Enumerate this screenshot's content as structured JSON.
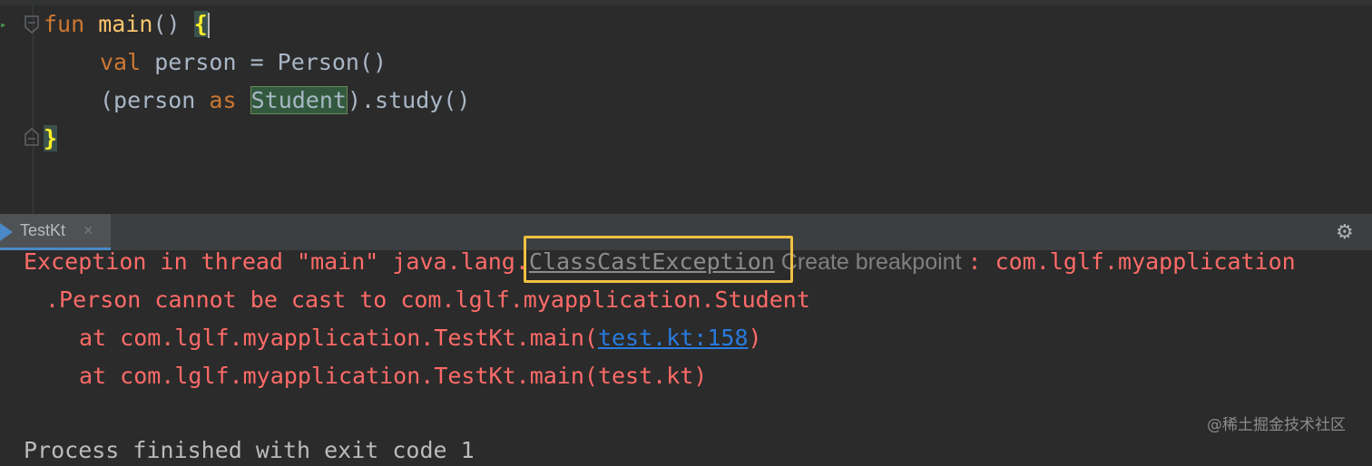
{
  "editor": {
    "line1": {
      "kw": "fun",
      "fn": "main",
      "rest": "() ",
      "brace": "{"
    },
    "line2": {
      "kw": "val",
      "rest": " person = Person()"
    },
    "line3": {
      "open": "(person ",
      "kw": "as",
      "space": " ",
      "type": "Student",
      "close": ").study()"
    },
    "line4": {
      "brace": "}"
    }
  },
  "run_panel": {
    "tab_label": "TestKt",
    "tab_close": "×",
    "settings_icon": "gear-icon"
  },
  "console": {
    "line1_prefix": "Exception in thread \"main\" java.lang.",
    "exception_link": "ClassCastException",
    "create_breakpoint": " Create breakpoint ",
    "line1_suffix": ": com.lglf.myapplication",
    "line2": ".Person cannot be cast to com.lglf.myapplication.Student",
    "line3_prefix": "at com.lglf.myapplication.TestKt.main(",
    "line3_link": "test.kt:158",
    "line3_suffix": ")",
    "line4": "at com.lglf.myapplication.TestKt.main(test.kt)",
    "line5": "Process finished with exit code 1"
  },
  "watermark": "@稀土掘金技术社区",
  "colors": {
    "background": "#2b2b2b",
    "keyword": "#cc7832",
    "function": "#ffc66d",
    "error": "#ff6b68",
    "link": "#287bde",
    "highlight_box": "#f0c040"
  }
}
